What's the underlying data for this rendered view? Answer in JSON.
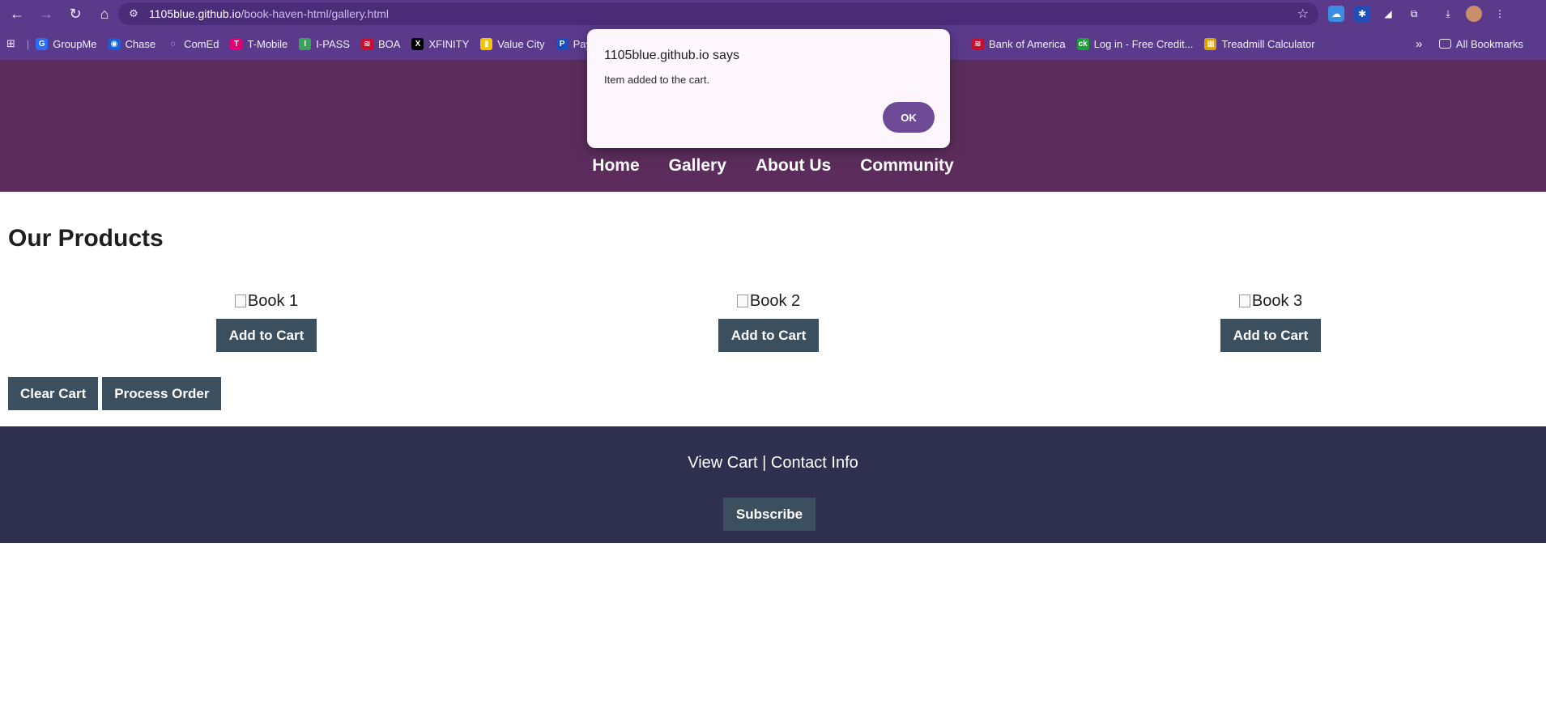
{
  "browser": {
    "url_host": "1105blue.github.io",
    "url_path": "/book-haven-html/gallery.html",
    "bookmarks": [
      {
        "label": "GroupMe",
        "color": "#2b6cf6",
        "glyph": "G"
      },
      {
        "label": "Chase",
        "color": "#1a5fd6",
        "glyph": "◉"
      },
      {
        "label": "ComEd",
        "color": "#5b3a8c",
        "glyph": "◌"
      },
      {
        "label": "T-Mobile",
        "color": "#e20074",
        "glyph": "T"
      },
      {
        "label": "I-PASS",
        "color": "#3aa35b",
        "glyph": "I"
      },
      {
        "label": "BOA",
        "color": "#c8102e",
        "glyph": "≋"
      },
      {
        "label": "XFINITY",
        "color": "#000000",
        "glyph": "X"
      },
      {
        "label": "Value City",
        "color": "#f5c400",
        "glyph": "▮"
      },
      {
        "label": "Pay",
        "color": "#1a4ec0",
        "glyph": "P"
      },
      {
        "label": "Bank of America",
        "color": "#c8102e",
        "glyph": "≋"
      },
      {
        "label": "Log in - Free Credit...",
        "color": "#1aa13a",
        "glyph": "ck"
      },
      {
        "label": "Treadmill Calculator",
        "color": "#d9a400",
        "glyph": "▦"
      }
    ],
    "all_bookmarks_label": "All Bookmarks"
  },
  "site": {
    "nav": [
      "Home",
      "Gallery",
      "About Us",
      "Community"
    ]
  },
  "products": {
    "title": "Our Products",
    "items": [
      {
        "alt": "Book 1",
        "button": "Add to Cart"
      },
      {
        "alt": "Book 2",
        "button": "Add to Cart"
      },
      {
        "alt": "Book 3",
        "button": "Add to Cart"
      }
    ],
    "clear_cart": "Clear Cart",
    "process_order": "Process Order"
  },
  "footer": {
    "view_cart": "View Cart",
    "separator": "|",
    "contact_info": "Contact Info",
    "subscribe": "Subscribe"
  },
  "dialog": {
    "title": "1105blue.github.io says",
    "message": "Item added to the cart.",
    "ok": "OK"
  },
  "colors": {
    "header": "#5c2d5c",
    "footer": "#2f2f4f",
    "button": "#3c4f5e",
    "chrome": "#5b3a8c"
  }
}
